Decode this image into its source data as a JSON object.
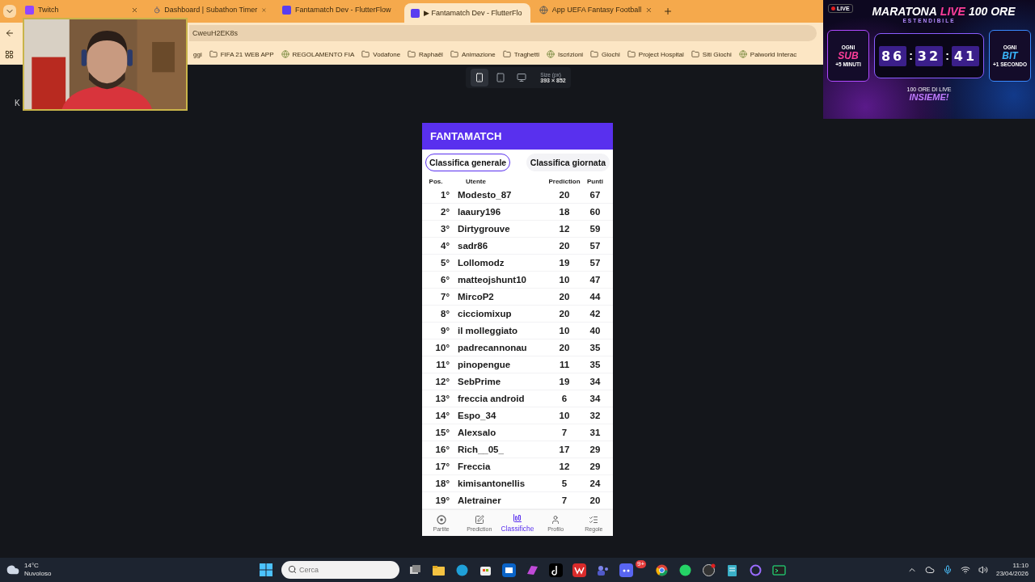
{
  "browser": {
    "tabs": [
      {
        "title": "Twitch",
        "kind": "twitch",
        "selected": false
      },
      {
        "title": "Dashboard | Subathon Timer",
        "kind": "timer",
        "selected": false
      },
      {
        "title": "Fantamatch Dev - FlutterFlow",
        "kind": "flutterflow",
        "selected": false
      },
      {
        "title": "▶ Fantamatch Dev - FlutterFlo",
        "kind": "flutterflow",
        "selected": true
      },
      {
        "title": "App UEFA Fantasy Football",
        "kind": "globe",
        "selected": false
      }
    ],
    "address": "CweuH2EK8s",
    "bookmarks": [
      {
        "label": "ggi",
        "kind": "plain"
      },
      {
        "label": "FIFA 21 WEB APP",
        "kind": "folder"
      },
      {
        "label": "REGOLAMENTO FIA",
        "kind": "site"
      },
      {
        "label": "Vodafone",
        "kind": "folder"
      },
      {
        "label": "Raphaël",
        "kind": "folder"
      },
      {
        "label": "Animazione",
        "kind": "folder"
      },
      {
        "label": "Traghetti",
        "kind": "folder"
      },
      {
        "label": "Iscrizioni",
        "kind": "site"
      },
      {
        "label": "Giochi",
        "kind": "folder"
      },
      {
        "label": "Project Hospital",
        "kind": "folder"
      },
      {
        "label": "Siti Giochi",
        "kind": "folder"
      },
      {
        "label": "Palworld Interac",
        "kind": "site"
      }
    ]
  },
  "builder": {
    "devices": [
      {
        "kind": "phone",
        "selected": true
      },
      {
        "kind": "tablet",
        "selected": false
      },
      {
        "kind": "desktop",
        "selected": false
      }
    ],
    "size_label": "Size (px)",
    "size_value": "393 × 852",
    "side_letter": "K"
  },
  "app": {
    "title": "FANTAMATCH",
    "tabs": [
      {
        "label": "Classifica generale",
        "selected": true
      },
      {
        "label": "Classifica giornata",
        "selected": false
      }
    ],
    "columns": [
      "Pos.",
      "Utente",
      "Prediction",
      "Punti"
    ],
    "rows": [
      {
        "pos": "1°",
        "user": "Modesto_87",
        "prediction": "20",
        "points": "67"
      },
      {
        "pos": "2°",
        "user": "laaury196",
        "prediction": "18",
        "points": "60"
      },
      {
        "pos": "3°",
        "user": "Dirtygrouve",
        "prediction": "12",
        "points": "59"
      },
      {
        "pos": "4°",
        "user": "sadr86",
        "prediction": "20",
        "points": "57"
      },
      {
        "pos": "5°",
        "user": "Lollomodz",
        "prediction": "19",
        "points": "57"
      },
      {
        "pos": "6°",
        "user": "matteojshunt10",
        "prediction": "10",
        "points": "47"
      },
      {
        "pos": "7°",
        "user": "MircoP2",
        "prediction": "20",
        "points": "44"
      },
      {
        "pos": "8°",
        "user": "cicciomixup",
        "prediction": "20",
        "points": "42"
      },
      {
        "pos": "9°",
        "user": "il molleggiato",
        "prediction": "10",
        "points": "40"
      },
      {
        "pos": "10°",
        "user": "padrecannonau",
        "prediction": "20",
        "points": "35"
      },
      {
        "pos": "11°",
        "user": "pinopengue",
        "prediction": "11",
        "points": "35"
      },
      {
        "pos": "12°",
        "user": "SebPrime",
        "prediction": "19",
        "points": "34"
      },
      {
        "pos": "13°",
        "user": "freccia android",
        "prediction": "6",
        "points": "34"
      },
      {
        "pos": "14°",
        "user": "Espo_34",
        "prediction": "10",
        "points": "32"
      },
      {
        "pos": "15°",
        "user": "Alexsalo",
        "prediction": "7",
        "points": "31"
      },
      {
        "pos": "16°",
        "user": "Rich__05_",
        "prediction": "17",
        "points": "29"
      },
      {
        "pos": "17°",
        "user": "Freccia",
        "prediction": "12",
        "points": "29"
      },
      {
        "pos": "18°",
        "user": "kimisantonellis",
        "prediction": "5",
        "points": "24"
      },
      {
        "pos": "19°",
        "user": "Aletrainer",
        "prediction": "7",
        "points": "20"
      }
    ],
    "nav": [
      {
        "label": "Partite",
        "kind": "ball",
        "selected": false
      },
      {
        "label": "Prediction",
        "kind": "edit",
        "selected": false
      },
      {
        "label": "Classifiche",
        "kind": "chart",
        "selected": true
      },
      {
        "label": "Profilo",
        "kind": "user",
        "selected": false
      },
      {
        "label": "Regole",
        "kind": "rules",
        "selected": false
      }
    ]
  },
  "overlay": {
    "live": "LIVE",
    "title_parts": [
      {
        "text": "MARATONA",
        "highlight": false
      },
      {
        "text": "LIVE",
        "highlight": true
      },
      {
        "text": "100 ORE",
        "highlight": false
      }
    ],
    "subtitle": "ESTENDIBILE",
    "timer": [
      "86",
      "32",
      "41"
    ],
    "separators": [
      ":",
      ":"
    ],
    "left": {
      "top": "OGNI",
      "main": "SUB",
      "bottom": "+5 MINUTI"
    },
    "right": {
      "top": "OGNI",
      "main": "BIT",
      "bottom": "+1 SECONDO"
    },
    "footer_top": "100 ORE DI LIVE",
    "footer_main": "INSIEME!"
  },
  "taskbar": {
    "temperature": "14°C",
    "weather": "Nuvoloso",
    "search": {
      "placeholder": "Cerca"
    },
    "apps": [
      {
        "kind": "taskview"
      },
      {
        "kind": "explorer"
      },
      {
        "kind": "edge"
      },
      {
        "kind": "store"
      },
      {
        "kind": "outlook"
      },
      {
        "kind": "m365"
      },
      {
        "kind": "tiktok"
      },
      {
        "kind": "wps"
      },
      {
        "kind": "teams"
      },
      {
        "kind": "discord",
        "badge": "9+"
      },
      {
        "kind": "chrome"
      },
      {
        "kind": "whatsapp"
      },
      {
        "kind": "obs"
      },
      {
        "kind": "notepad"
      },
      {
        "kind": "ring"
      },
      {
        "kind": "terminal"
      }
    ],
    "time": "11:10",
    "date": "23/04/2026"
  }
}
